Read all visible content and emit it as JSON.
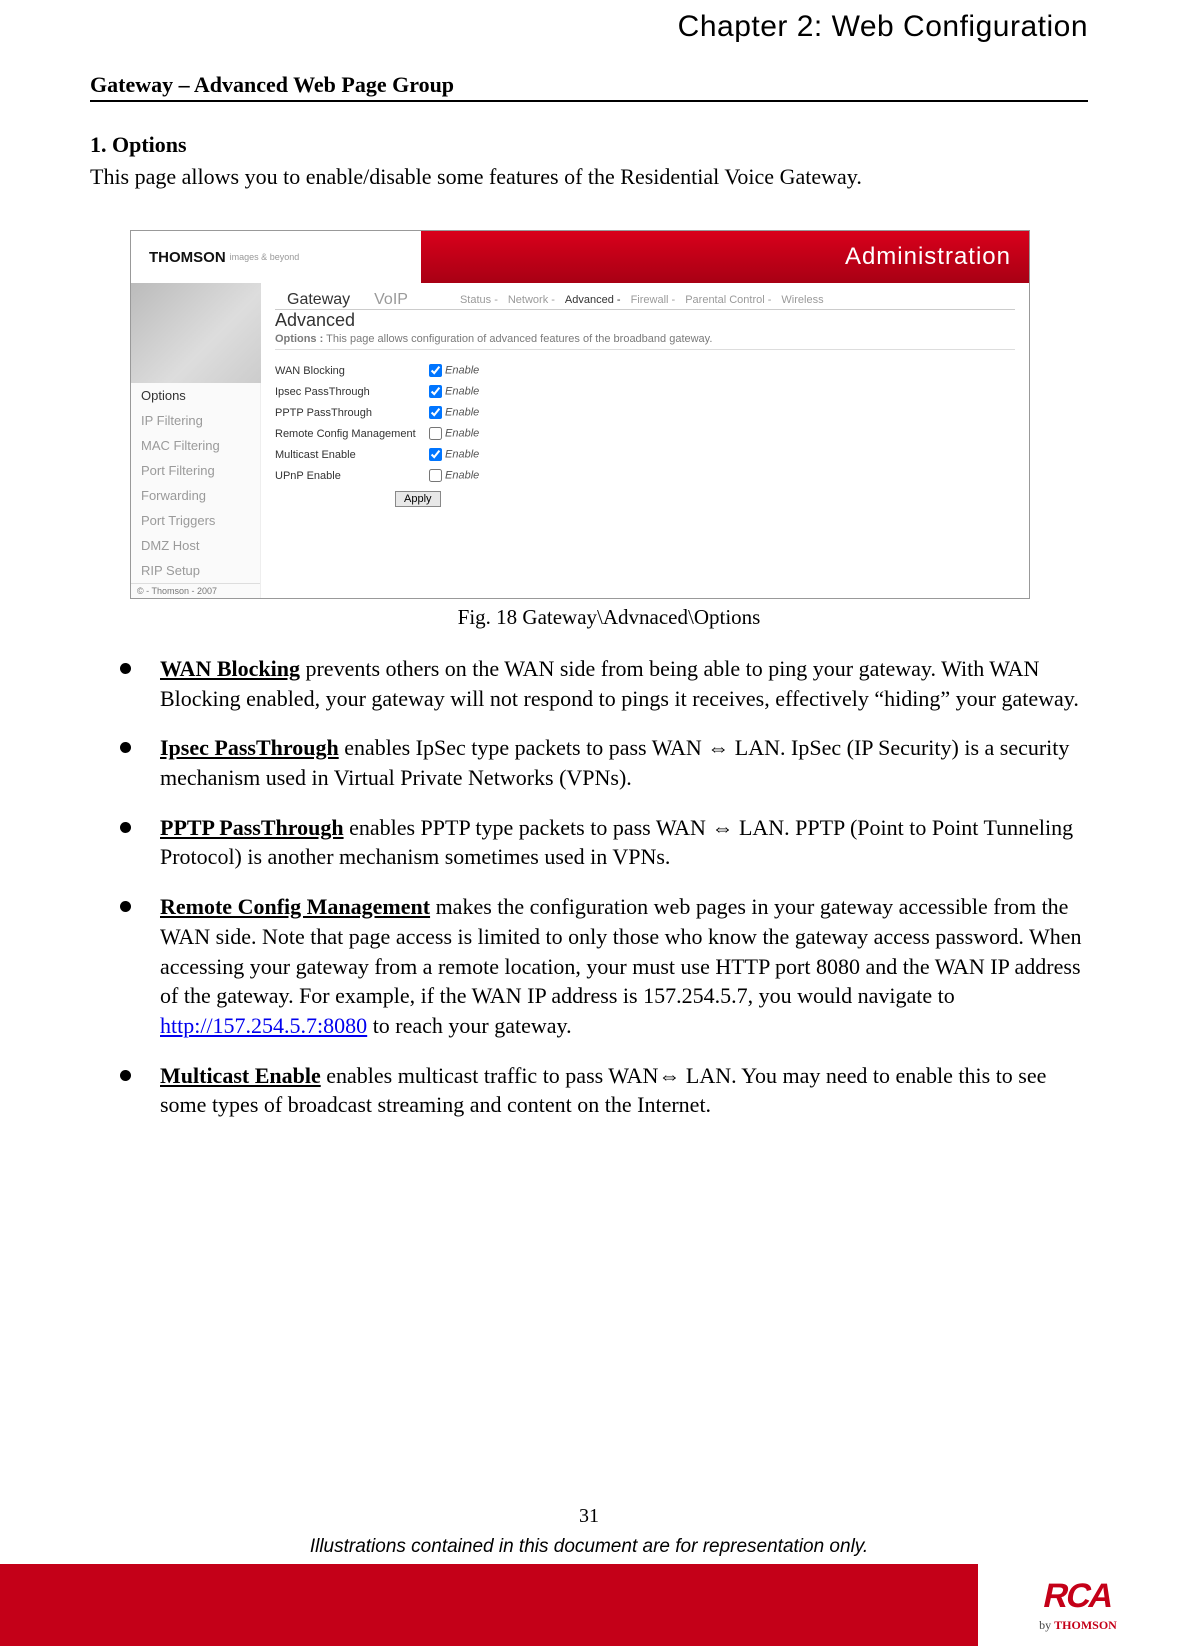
{
  "chapter_title": "Chapter 2: Web Configuration",
  "section_title": "Gateway – Advanced Web Page Group",
  "sub_title": "1. Options",
  "intro": "This page allows you to enable/disable some features of the Residential Voice Gateway.",
  "figure": {
    "brand_name": "THOMSON",
    "brand_sub": "images & beyond",
    "admin_label": "Administration",
    "tabs": [
      {
        "label": "Gateway",
        "active": true
      },
      {
        "label": "VoIP",
        "active": false
      }
    ],
    "subnav": [
      {
        "label": "Status -",
        "current": false
      },
      {
        "label": "Network -",
        "current": false
      },
      {
        "label": "Advanced -",
        "current": true
      },
      {
        "label": "Firewall -",
        "current": false
      },
      {
        "label": "Parental Control -",
        "current": false
      },
      {
        "label": "Wireless",
        "current": false
      }
    ],
    "side_items": [
      {
        "label": "Options",
        "current": true
      },
      {
        "label": "IP Filtering",
        "current": false
      },
      {
        "label": "MAC Filtering",
        "current": false
      },
      {
        "label": "Port Filtering",
        "current": false
      },
      {
        "label": "Forwarding",
        "current": false
      },
      {
        "label": "Port Triggers",
        "current": false
      },
      {
        "label": "DMZ Host",
        "current": false
      },
      {
        "label": "RIP Setup",
        "current": false
      }
    ],
    "main_heading": "Advanced",
    "main_desc_label": "Options :",
    "main_desc": "This page allows configuration of advanced features of the broadband gateway.",
    "options": [
      {
        "label": "WAN Blocking",
        "checked": true
      },
      {
        "label": "Ipsec PassThrough",
        "checked": true
      },
      {
        "label": "PPTP PassThrough",
        "checked": true
      },
      {
        "label": "Remote Config Management",
        "checked": false
      },
      {
        "label": "Multicast Enable",
        "checked": true
      },
      {
        "label": "UPnP Enable",
        "checked": false
      }
    ],
    "enable_text": "Enable",
    "apply_label": "Apply",
    "copyright": "© - Thomson - 2007",
    "caption": "Fig. 18 Gateway\\Advnaced\\Options"
  },
  "bullets": [
    {
      "term": "WAN Blocking",
      "rest": " prevents others on the WAN side from being able to ping your gateway. With WAN Blocking enabled, your gateway will not respond to pings it receives, effectively “hiding” your gateway."
    },
    {
      "term": "Ipsec PassThrough",
      "rest": " enables IpSec type packets to pass WAN ⇔ LAN. IpSec (IP Security) is a security mechanism used in Virtual Private Networks (VPNs)."
    },
    {
      "term": "PPTP PassThrough",
      "rest": " enables PPTP type packets to pass WAN ⇔ LAN. PPTP (Point to Point Tunneling Protocol) is another mechanism sometimes used in VPNs."
    },
    {
      "term": "Remote Config Management",
      "rest_before_link": " makes the configuration web pages in your gateway accessible from the WAN side. Note that page access is limited to only those who know the gateway access password. When accessing your gateway from a remote location, your must use HTTP port 8080 and the WAN IP address of the gateway. For example, if the WAN IP address is 157.254.5.7, you would navigate to ",
      "link": "http://157.254.5.7:8080",
      "rest_after_link": " to reach your gateway."
    },
    {
      "term": "Multicast Enable",
      "rest": " enables multicast traffic to pass WAN⇔ LAN. You may need to enable this to see some types of broadcast streaming and content on the Internet."
    }
  ],
  "page_number": "31",
  "disclaimer": "Illustrations contained in this document are for representation only.",
  "footer": {
    "logo": "RCA",
    "by": "by",
    "brand": "THOMSON"
  }
}
